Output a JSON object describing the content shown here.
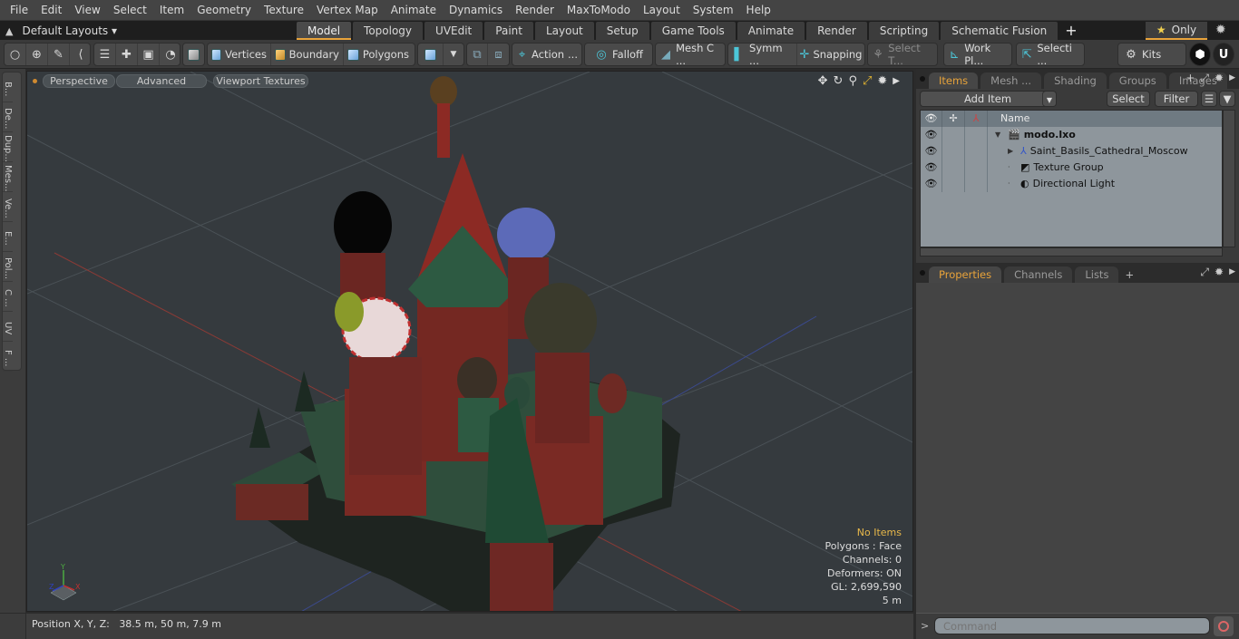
{
  "menu": [
    "File",
    "Edit",
    "View",
    "Select",
    "Item",
    "Geometry",
    "Texture",
    "Vertex Map",
    "Animate",
    "Dynamics",
    "Render",
    "MaxToModo",
    "Layout",
    "System",
    "Help"
  ],
  "layouts": {
    "label": "Default Layouts",
    "icon": "layout-up-arrow-icon"
  },
  "mode_tabs": [
    {
      "label": "Model",
      "active": true
    },
    {
      "label": "Topology"
    },
    {
      "label": "UVEdit"
    },
    {
      "label": "Paint"
    },
    {
      "label": "Layout"
    },
    {
      "label": "Setup"
    },
    {
      "label": "Game Tools"
    },
    {
      "label": "Animate"
    },
    {
      "label": "Render"
    },
    {
      "label": "Scripting"
    },
    {
      "label": "Schematic Fusion"
    }
  ],
  "only_button": "Only",
  "toolbar": {
    "vertices": "Vertices",
    "boundary": "Boundary",
    "polygons": "Polygons",
    "action": "Action",
    "action_more": "...",
    "falloff": "Falloff",
    "mesh_c": "Mesh C ...",
    "symm": "Symm ...",
    "snapping": "Snapping",
    "select_t": "Select T...",
    "work_pl": "Work Pl...",
    "selecti": "Selecti ...",
    "kits": "Kits"
  },
  "left_tabs": [
    "B...",
    "De...",
    "Dup...",
    "Mes...",
    "Ve...",
    "E...",
    "Pol...",
    "C ...",
    "UV",
    "F ..."
  ],
  "viewport": {
    "perspective": "Perspective",
    "advanced": "Advanced",
    "viewport_textures": "Viewport Textures",
    "info": {
      "selection": "No Items",
      "polygons": "Polygons : Face",
      "channels": "Channels: 0",
      "deformers": "Deformers: ON",
      "gl": "GL: 2,699,590",
      "scale": "5 m"
    },
    "axis": {
      "x": "X",
      "y": "Y",
      "z": "Z"
    }
  },
  "status": {
    "position_label": "Position X, Y, Z:",
    "position_value": "38.5 m, 50 m, 7.9 m"
  },
  "items_panel": {
    "tabs": [
      {
        "label": "Items",
        "active": true
      },
      {
        "label": "Mesh ..."
      },
      {
        "label": "Shading"
      },
      {
        "label": "Groups"
      },
      {
        "label": "Images"
      }
    ],
    "add_item": "Add Item",
    "select": "Select",
    "filter": "Filter",
    "column_name": "Name",
    "tree": [
      {
        "name": "modo.lxo",
        "icon": "scene-clapper-icon",
        "bold": true,
        "expanded": true,
        "indent": 0
      },
      {
        "name": "Saint_Basils_Cathedral_Moscow",
        "icon": "mesh-locator-icon",
        "collapsed": true,
        "indent": 1
      },
      {
        "name": "Texture Group",
        "icon": "texture-group-icon",
        "indent": 1
      },
      {
        "name": "Directional Light",
        "icon": "directional-light-icon",
        "indent": 1
      }
    ]
  },
  "props_panel": {
    "tabs": [
      {
        "label": "Properties",
        "active": true
      },
      {
        "label": "Channels"
      },
      {
        "label": "Lists"
      }
    ]
  },
  "command": {
    "placeholder": "Command",
    "prompt": ">"
  }
}
